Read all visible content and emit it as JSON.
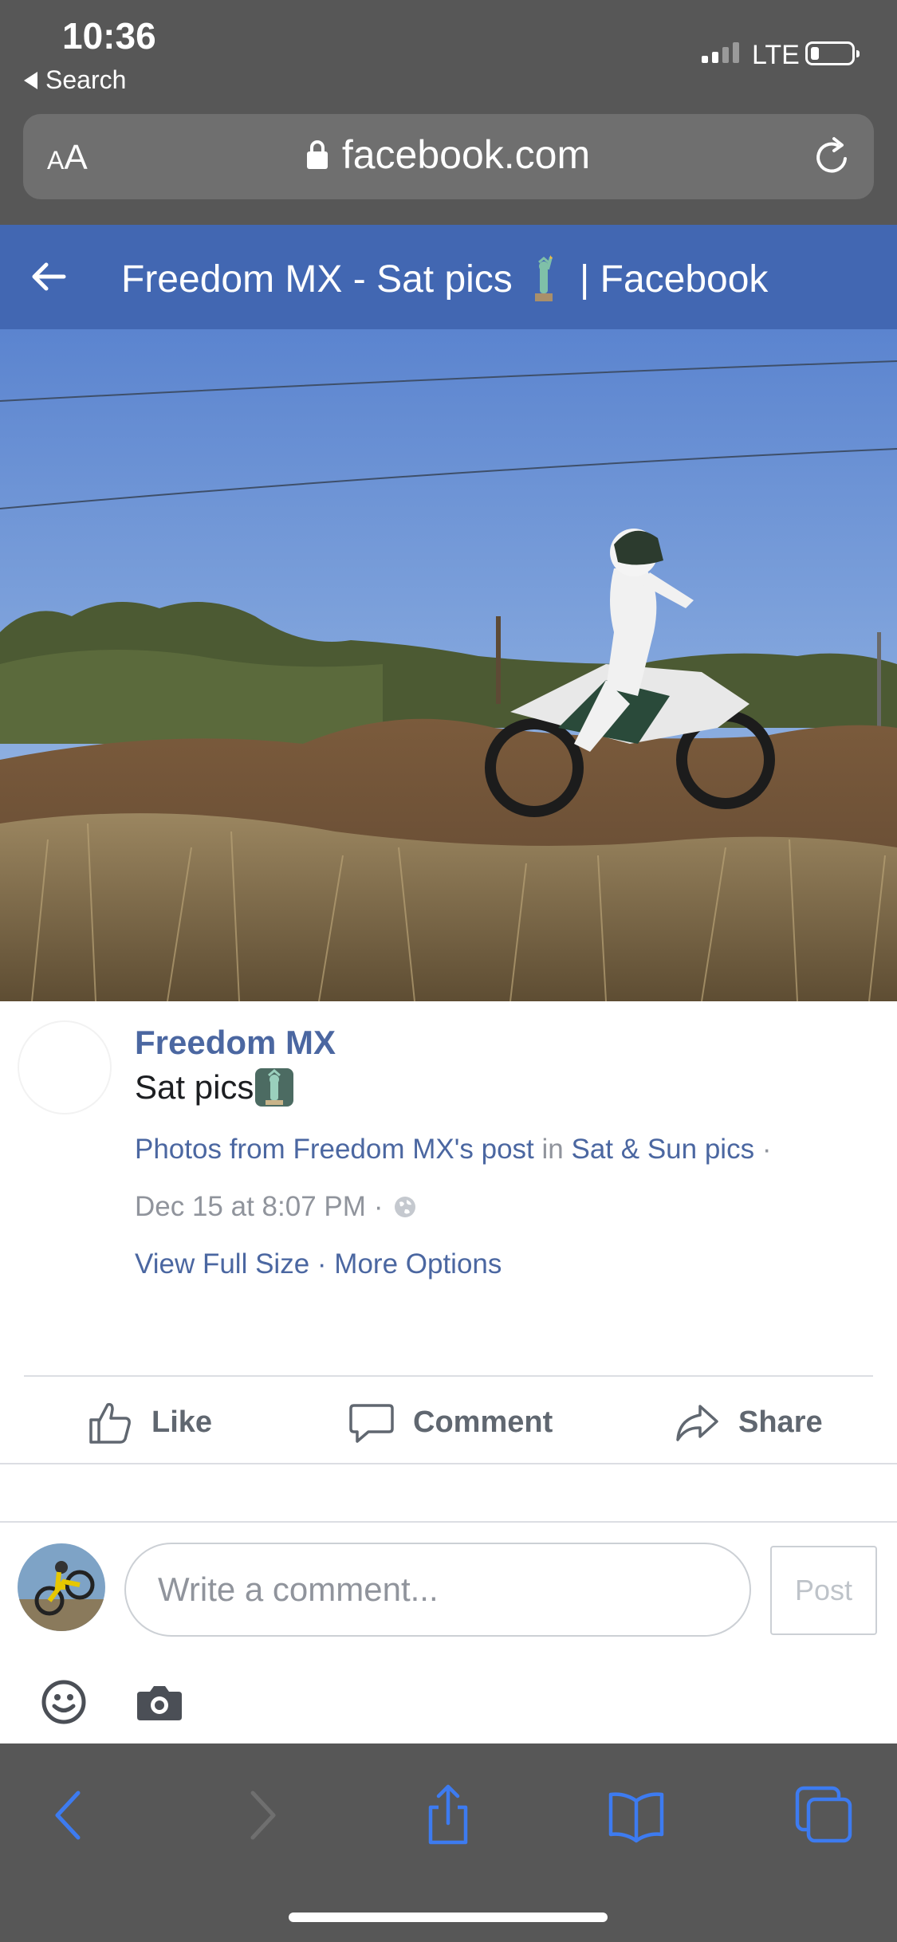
{
  "status_bar": {
    "time": "10:36",
    "back_label": "Search",
    "network": "LTE",
    "battery_level": 0.2
  },
  "browser": {
    "text_size_label_small": "A",
    "text_size_label_large": "A",
    "url": "facebook.com",
    "icons": [
      "lock-icon",
      "reload-icon"
    ]
  },
  "fb_header": {
    "title_prefix": "Freedom MX - Sat pics",
    "title_suffix": "| Facebook",
    "icons": [
      "back-arrow-icon",
      "statue-of-liberty-icon"
    ]
  },
  "post": {
    "author": "Freedom MX",
    "text": "Sat pics",
    "meta": {
      "photos_from": "Photos from",
      "post_link": "Freedom MX's post",
      "in_word": "in",
      "album_link": "Sat & Sun pics",
      "sep": "·",
      "timestamp": "Dec 15 at 8:07 PM",
      "view_full_size": "View Full Size",
      "more_options": "More Options"
    }
  },
  "actions": {
    "like": "Like",
    "comment": "Comment",
    "share": "Share"
  },
  "composer": {
    "placeholder": "Write a comment...",
    "post_button": "Post",
    "icons": [
      "emoji-icon",
      "camera-icon"
    ]
  },
  "toolbar": {
    "icons": [
      "back-icon",
      "forward-icon",
      "share-icon",
      "bookmarks-icon",
      "tabs-icon"
    ]
  },
  "colors": {
    "fb_blue": "#4267b2",
    "link": "#4b67a1",
    "safari_chrome": "#575757",
    "toolbar_icon": "#3d7bf0"
  }
}
